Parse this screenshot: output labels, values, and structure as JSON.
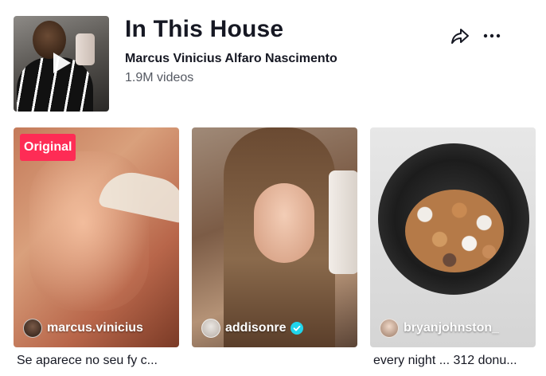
{
  "sound": {
    "title": "In This House",
    "author": "Marcus Vinicius Alfaro Nascimento",
    "video_count": "1.9M videos",
    "cover_icon": "play-icon"
  },
  "actions": {
    "share_icon": "share-icon",
    "more_icon": "more-icon"
  },
  "videos": [
    {
      "badge": "Original",
      "username": "marcus.vinicius",
      "verified": false,
      "caption": "Se aparece no seu fy c..."
    },
    {
      "badge": "",
      "username": "addisonre",
      "verified": true,
      "caption": ""
    },
    {
      "badge": "",
      "username": "bryanjohnston_",
      "verified": false,
      "caption": "every night ... 312 donu..."
    }
  ],
  "colors": {
    "badge_bg": "#fe2c55",
    "verified": "#20d5ec",
    "text_primary": "#161823",
    "text_secondary": "#555962"
  }
}
